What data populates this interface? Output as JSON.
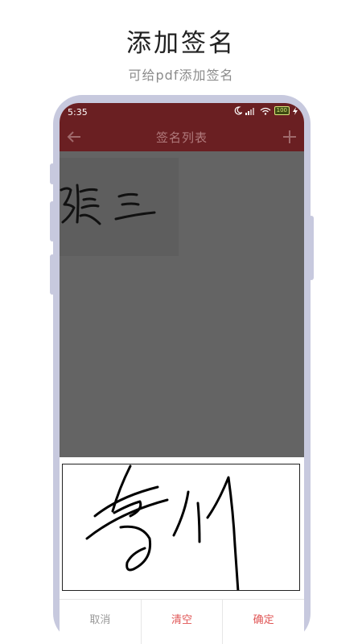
{
  "promo": {
    "title": "添加签名",
    "subtitle": "可给pdf添加签名"
  },
  "status_bar": {
    "time": "5:35",
    "battery": "100"
  },
  "app_bar": {
    "title": "签名列表",
    "back_icon": "arrow-left-icon",
    "add_icon": "plus-icon"
  },
  "signature_list": {
    "items": [
      {
        "label": "signature-1"
      }
    ]
  },
  "actions": {
    "cancel_label": "取消",
    "clear_label": "清空",
    "confirm_label": "确定"
  },
  "colors": {
    "app_bar": "#6a1f22",
    "list_background": "#646464",
    "phone_frame": "#c7c9de",
    "accent_red": "#e05555"
  }
}
